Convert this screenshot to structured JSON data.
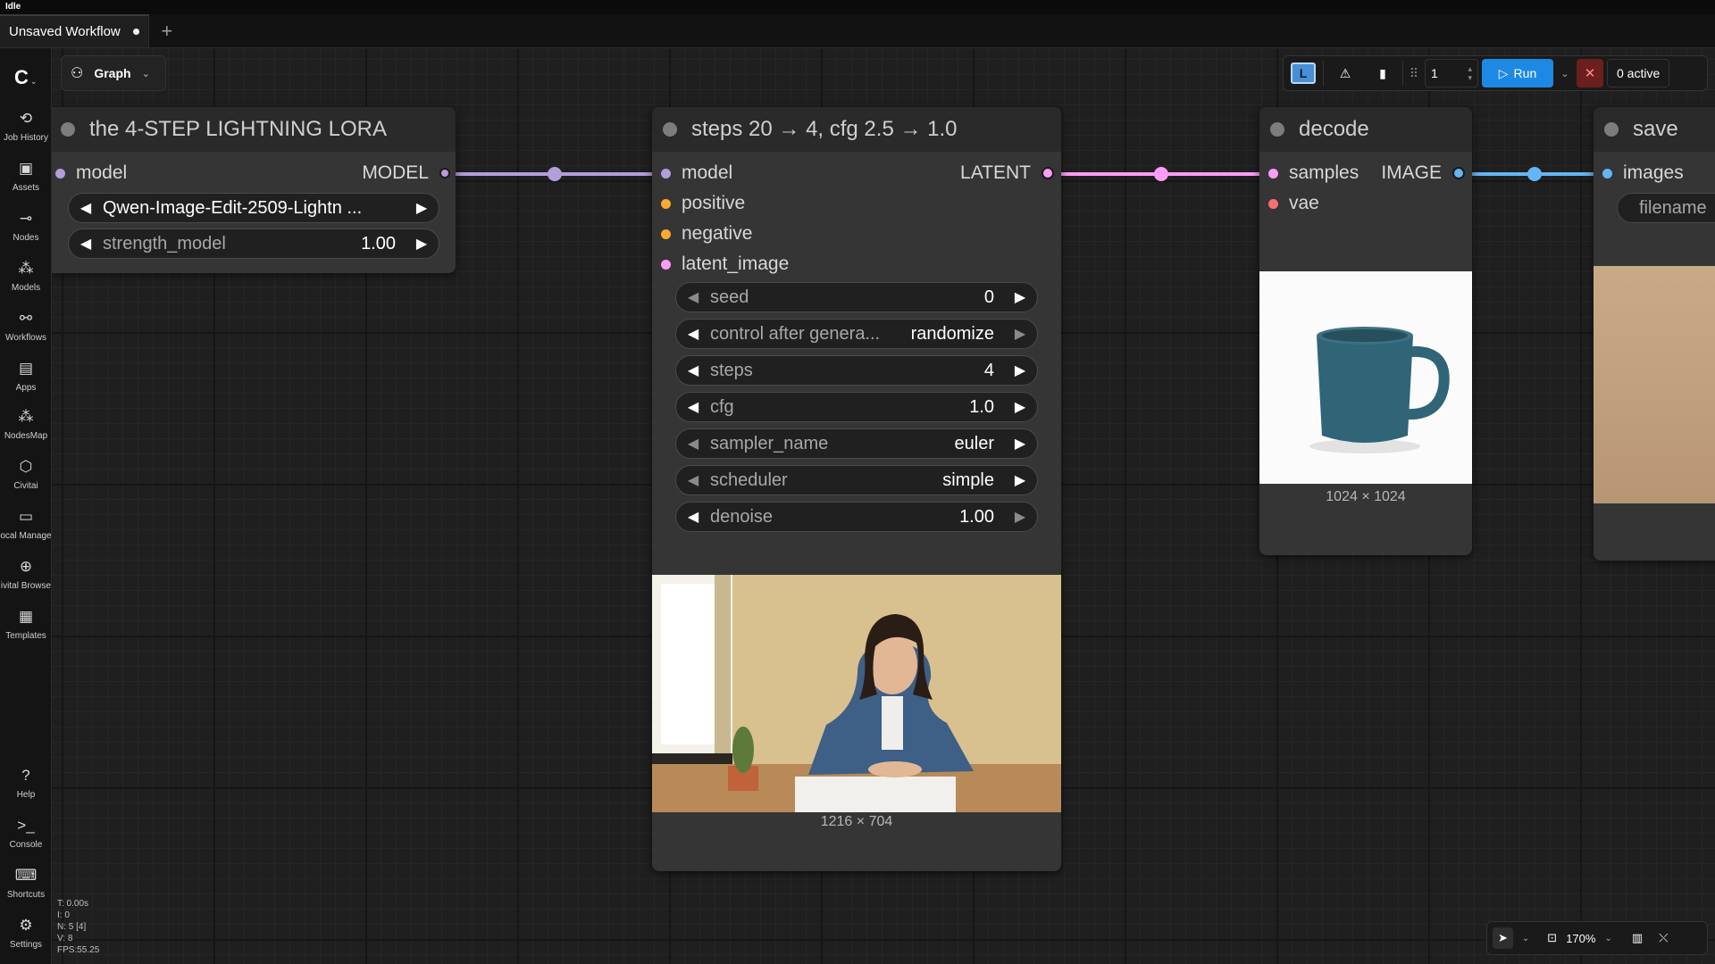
{
  "status": "Idle",
  "tabs": [
    {
      "label": "Unsaved Workflow"
    }
  ],
  "graph_menu": {
    "label": "Graph"
  },
  "sidebar": {
    "items": [
      {
        "label": "Job History",
        "icon": "history-icon"
      },
      {
        "label": "Assets",
        "icon": "image-icon"
      },
      {
        "label": "Nodes",
        "icon": "nodes-icon"
      },
      {
        "label": "Models",
        "icon": "models-icon"
      },
      {
        "label": "Workflows",
        "icon": "workflows-icon"
      },
      {
        "label": "Apps",
        "icon": "apps-icon"
      },
      {
        "label": "NodesMap",
        "icon": "nodesmap-icon"
      },
      {
        "label": "Civitai",
        "icon": "civitai-icon"
      },
      {
        "label": "ocal Manage",
        "icon": "folder-icon"
      },
      {
        "label": "ivital Browse",
        "icon": "globe-icon"
      },
      {
        "label": "Templates",
        "icon": "templates-icon"
      }
    ],
    "bottom_items": [
      {
        "label": "Help",
        "icon": "help-icon"
      },
      {
        "label": "Console",
        "icon": "console-icon"
      },
      {
        "label": "Shortcuts",
        "icon": "keyboard-icon"
      },
      {
        "label": "Settings",
        "icon": "gear-icon"
      }
    ]
  },
  "toolbar": {
    "queue_count": "1",
    "run_label": "Run",
    "active_label": "0 active"
  },
  "nodes": {
    "lora": {
      "title": "the 4-STEP LIGHTNING LORA",
      "input_model": "model",
      "output_model": "MODEL",
      "lora_name": "Qwen-Image-Edit-2509-Lightn ...",
      "strength_label": "strength_model",
      "strength_value": "1.00"
    },
    "sampler": {
      "title": "steps 20 → 4,  cfg 2.5 → 1.0",
      "inputs": [
        "model",
        "positive",
        "negative",
        "latent_image"
      ],
      "output": "LATENT",
      "widgets": [
        {
          "label": "seed",
          "value": "0"
        },
        {
          "label": "control after genera...",
          "value": "randomize"
        },
        {
          "label": "steps",
          "value": "4"
        },
        {
          "label": "cfg",
          "value": "1.0"
        },
        {
          "label": "sampler_name",
          "value": "euler"
        },
        {
          "label": "scheduler",
          "value": "simple"
        },
        {
          "label": "denoise",
          "value": "1.00"
        }
      ],
      "preview_caption": "1216 × 704"
    },
    "decode": {
      "title": "decode",
      "inputs": [
        "samples",
        "vae"
      ],
      "output": "IMAGE",
      "preview_caption": "1024 × 1024"
    },
    "save": {
      "title": "save",
      "input": "images",
      "widget": "filename"
    }
  },
  "colors": {
    "model_link": "#b39ddb",
    "latent_link": "#ff9cf9",
    "image_link": "#64b5f6",
    "conditioning_pin": "#ffa931",
    "vae_pin": "#ff6e6e",
    "run_button": "#1e88e5"
  },
  "bottom_controls": {
    "zoom": "170%"
  },
  "stats": {
    "t": "T: 0.00s",
    "i": "I: 0",
    "n": "N: 5 [4]",
    "v": "V: 8",
    "fps": "FPS:55.25"
  }
}
